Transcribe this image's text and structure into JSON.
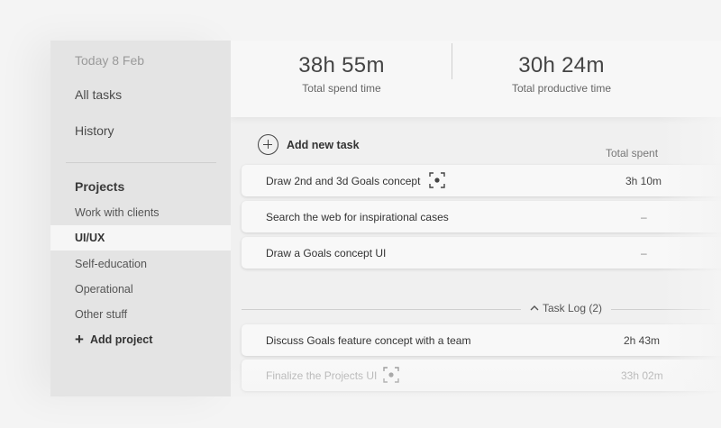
{
  "sidebar": {
    "date": "Today 8 Feb",
    "nav": [
      {
        "label": "All tasks"
      },
      {
        "label": "History"
      }
    ],
    "projects_title": "Projects",
    "projects": [
      {
        "label": "Work with clients"
      },
      {
        "label": "UI/UX",
        "active": true
      },
      {
        "label": "Self-education"
      },
      {
        "label": "Operational"
      },
      {
        "label": "Other stuff"
      }
    ],
    "add_project": "Add project"
  },
  "stats": {
    "spend": {
      "value": "38h 55m",
      "label": "Total spend time"
    },
    "productive": {
      "value": "30h 24m",
      "label": "Total productive time"
    }
  },
  "tasks_panel": {
    "add_task": "Add new task",
    "col_total_spent": "Total spent",
    "tasks": [
      {
        "name": "Draw 2nd and 3d Goals concept",
        "time": "3h 10m",
        "focus_icon": "focus-icon"
      },
      {
        "name": "Search the web for inspirational cases",
        "time": "–"
      },
      {
        "name": "Draw a Goals concept UI",
        "time": "–"
      }
    ],
    "task_log": {
      "label": "Task Log (2)",
      "icon": "chevron-up-icon",
      "items": [
        {
          "name": "Discuss Goals feature concept with a team",
          "time": "2h 43m"
        },
        {
          "name": "Finalize the Projects UI",
          "time": "33h 02m",
          "focus_icon": "focus-icon"
        }
      ]
    }
  },
  "colors": {
    "sidebar_bg": "#e4e4e4",
    "main_bg": "#f0f0f0",
    "active_item_bg": "#f6f6f6",
    "text_primary": "#333333"
  }
}
